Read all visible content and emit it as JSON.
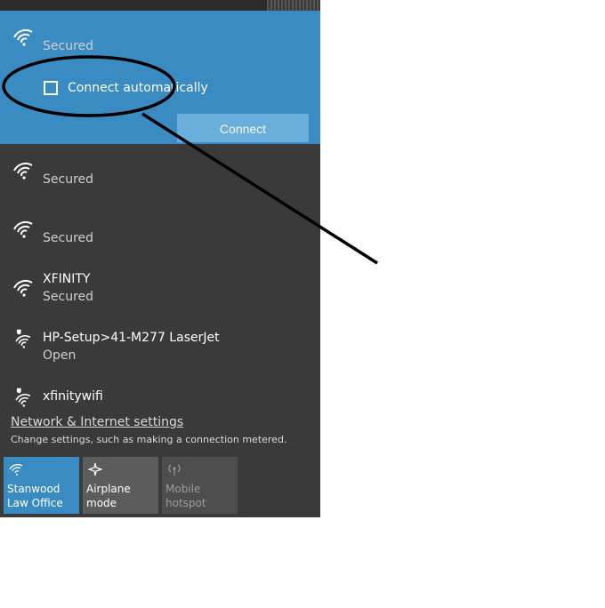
{
  "networks": {
    "selected": {
      "ssid": "",
      "status": "Secured",
      "auto_label": "Connect automatically",
      "connect_label": "Connect"
    },
    "list": [
      {
        "ssid": "",
        "status": "Secured"
      },
      {
        "ssid": "",
        "status": "Secured"
      },
      {
        "ssid": "XFINITY",
        "status": "Secured"
      },
      {
        "ssid": "HP-Setup>41-M277 LaserJet",
        "status": "Open"
      },
      {
        "ssid": "xfinitywifi",
        "status": ""
      }
    ]
  },
  "footer": {
    "settings_link": "Network & Internet settings",
    "settings_desc": "Change settings, such as making a connection metered."
  },
  "quick_actions": [
    {
      "label": "Stanwood Law Office",
      "icon": "wifi-icon"
    },
    {
      "label": "Airplane mode",
      "icon": "airplane-icon"
    },
    {
      "label": "Mobile hotspot",
      "icon": "hotspot-icon"
    }
  ],
  "colors": {
    "panel": "#3a3a3a",
    "accent": "#3a8bc2",
    "button": "#6aaedb"
  }
}
